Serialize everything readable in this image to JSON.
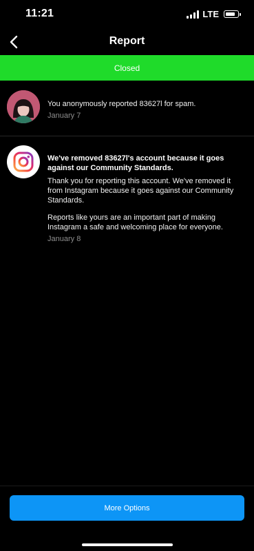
{
  "status_bar": {
    "time": "11:21",
    "network": "LTE"
  },
  "nav": {
    "title": "Report",
    "back_icon": "chevron-left-icon"
  },
  "banner": {
    "label": "Closed",
    "color": "#1fdb2a"
  },
  "report_item": {
    "text": "You anonymously reported 83627l for spam.",
    "date": "January 7"
  },
  "removal_item": {
    "heading": "We've removed 83627l's account because it goes against our Community Standards.",
    "body_1": "Thank you for reporting this account. We've removed it from Instagram because it goes against our Community Standards.",
    "body_2": "Reports like yours are an important part of making Instagram a safe and welcoming place for everyone.",
    "date": "January 8",
    "icon": "instagram-logo-icon"
  },
  "footer": {
    "button_label": "More Options",
    "button_color": "#0d95f6"
  }
}
